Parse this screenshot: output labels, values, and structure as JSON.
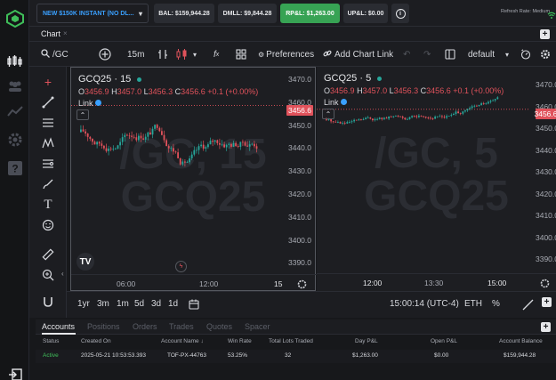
{
  "topbar": {
    "account_label": "NEW $150K INSTANT (NO DL...",
    "bal": "BAL: $159,944.28",
    "dmll": "DMLL: $9,844.28",
    "rpl": "RP&L: $1,263.00",
    "upl": "UP&L: $0.00",
    "refresh_rate": "Refresh Rate: Medium"
  },
  "tab": {
    "label": "Chart"
  },
  "toolbar": {
    "symbol": "/GC",
    "interval": "15m",
    "preferences": "Preferences",
    "add_chart_link": "Add Chart Link",
    "layout": "default"
  },
  "pane1": {
    "title": "GCQ25 · 15",
    "ohlc": {
      "o": "3456.9",
      "h": "3457.0",
      "l": "3456.3",
      "c": "3456.6",
      "chg": "+0.1 (+0.00%)"
    },
    "link": "Link",
    "watermark_line1": "/GC, 15",
    "watermark_line2": "GCQ25",
    "price_ticks": [
      "3470.0",
      "3460.0",
      "3450.0",
      "3440.0",
      "3430.0",
      "3420.0",
      "3410.0",
      "3400.0",
      "3390.0"
    ],
    "price_tag": "3456.6",
    "time_ticks": [
      "06:00",
      "12:00",
      "15"
    ]
  },
  "pane2": {
    "title": "GCQ25 · 5",
    "ohlc": {
      "o": "3456.9",
      "h": "3457.0",
      "l": "3456.3",
      "c": "3456.6",
      "chg": "+0.1 (+0.00%)"
    },
    "link": "Link",
    "watermark_line1": "/GC, 5",
    "watermark_line2": "GCQ25",
    "price_ticks": [
      "3470.0",
      "3460.0",
      "3450.0",
      "3440.0",
      "3430.0",
      "3420.0",
      "3410.0",
      "3400.0",
      "3390.0"
    ],
    "price_tag": "3456.6",
    "time_ticks": [
      "12:00",
      "13:30",
      "15:00"
    ]
  },
  "rangebar": {
    "ranges": [
      "1yr",
      "3m",
      "1m",
      "5d",
      "3d",
      "1d"
    ],
    "clock": "15:00:14 (UTC-4)",
    "session": "ETH",
    "percent": "%"
  },
  "bottom": {
    "tabs": [
      "Accounts",
      "Positions",
      "Orders",
      "Trades",
      "Quotes",
      "Spacer"
    ],
    "columns": [
      "Status",
      "Created On",
      "Account Name",
      "Win Rate",
      "Total Lots Traded",
      "Day P&L",
      "Open P&L",
      "Account Balance"
    ],
    "row": [
      "Active",
      "2025-05-21 10:53:53.393",
      "TOF-PX-44763",
      "53.25%",
      "32",
      "$1,263.00",
      "$0.00",
      "$159,944.28"
    ]
  },
  "colors": {
    "up": "#26a69a",
    "down": "#e0525b",
    "accent": "#3aa0ff",
    "positive": "#37a354"
  }
}
